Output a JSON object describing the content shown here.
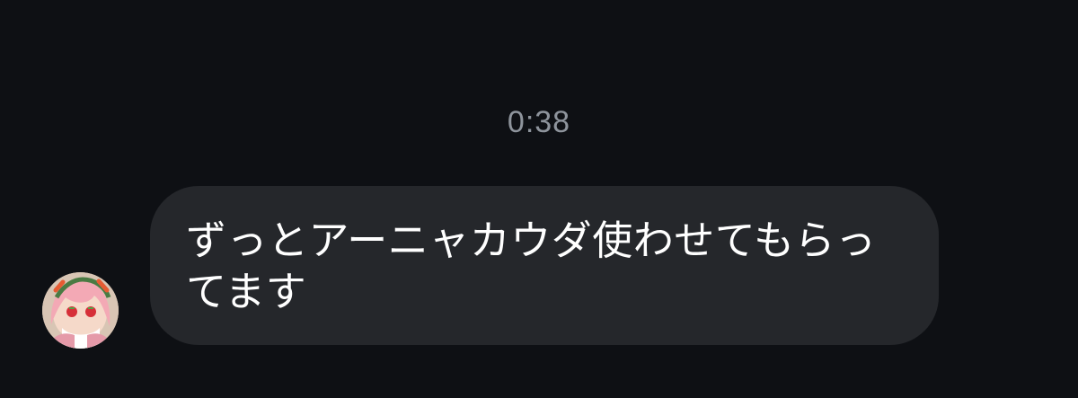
{
  "conversation": {
    "timestamp": "0:38",
    "messages": [
      {
        "sender_avatar": "avatar-image",
        "text": "ずっとアーニャカウダ使わせてもらってます"
      }
    ]
  },
  "colors": {
    "background": "#0e1014",
    "bubble": "#25272b",
    "timestamp_text": "#8e949c",
    "message_text": "#ffffff"
  }
}
